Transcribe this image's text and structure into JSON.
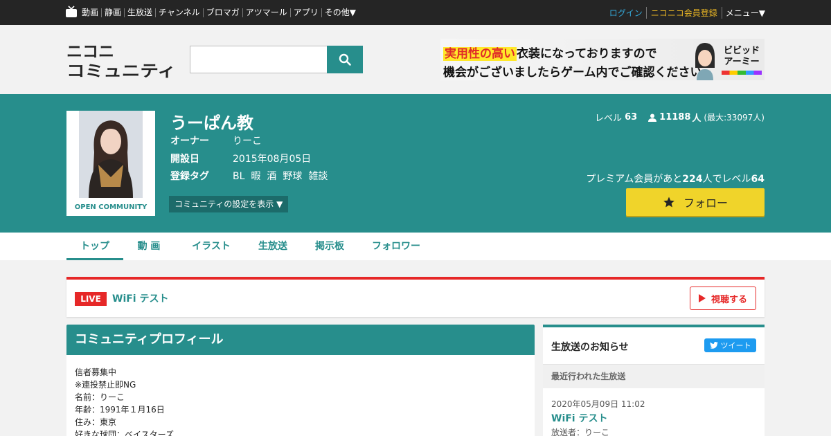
{
  "topbar": {
    "nav": [
      "動画",
      "静画",
      "生放送",
      "チャンネル",
      "ブロマガ",
      "アツマール",
      "アプリ",
      "その他▼"
    ],
    "login": "ログイン",
    "register": "ニコニコ会員登録",
    "menu": "メニュー▼"
  },
  "header": {
    "logo_line1": "ニコニ",
    "logo_line2": "コミュニティ",
    "search_placeholder": "",
    "banner": {
      "highlight": "実用性の高い",
      "line1_rest": "衣装になっておりますので",
      "line2": "機会がございましたらゲーム内でご確認ください。",
      "brand_line1": "ビビッド",
      "brand_line2": "アーミー"
    }
  },
  "community": {
    "title": "うーぱん教",
    "thumb_badge": "OPEN COMMUNITY",
    "owner_label": "オーナー",
    "owner": "りーこ",
    "created_label": "開設日",
    "created": "2015年08月05日",
    "tags_label": "登録タグ",
    "tags": [
      "BL",
      "暇",
      "酒",
      "野球",
      "雑談"
    ],
    "settings_button": "コミュニティの設定を表示 ▼",
    "level_label": "レベル",
    "level": "63",
    "members": "11188",
    "members_unit": "人",
    "members_max": "(最大:33097人)",
    "premium_text_prefix": "プレミアム会員があと",
    "premium_count": "224",
    "premium_text_mid": "人でレベル",
    "premium_target": "64",
    "follow_button": "フォロー",
    "accent_color": "#278e8c",
    "follow_color": "#f0d42a"
  },
  "tabs": [
    "トップ",
    "動 画",
    "イラスト",
    "生放送",
    "掲示板",
    "フォロワー"
  ],
  "live": {
    "badge": "LIVE",
    "title": "WiFi テスト",
    "watch_button": "視聴する"
  },
  "profile": {
    "heading": "コミュニティプロフィール",
    "lines": [
      "信者募集中",
      "※連投禁止即NG",
      "名前：りーこ",
      "年齢：1991年１月16日",
      "住み：東京",
      "好きな球団：ベイスターズ"
    ]
  },
  "side": {
    "title": "生放送のお知らせ",
    "tweet_button": "ツイート",
    "recent_label": "最近行われた生放送",
    "item": {
      "date": "2020年05月09日 11:02",
      "title": "WiFi テスト",
      "broadcaster": "放送者：りーこ"
    }
  }
}
